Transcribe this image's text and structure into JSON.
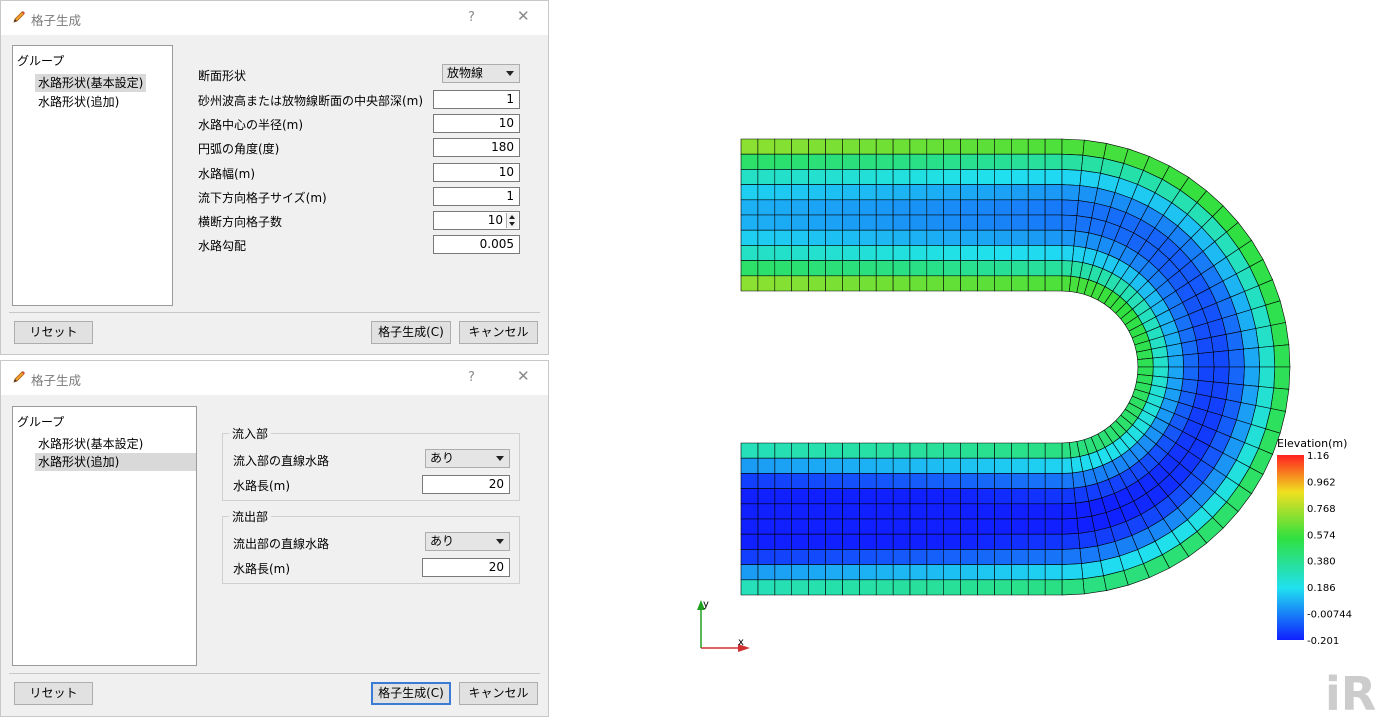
{
  "dialog1": {
    "title": "格子生成",
    "help": "?",
    "close": "✕",
    "group_title": "グループ",
    "groups": [
      "水路形状(基本設定)",
      "水路形状(追加)"
    ],
    "selected_group": 0,
    "section_shape_label": "断面形状",
    "section_shape_value": "放物線",
    "fields": [
      {
        "label": "砂州波高または放物線断面の中央部深(m)",
        "value": "1"
      },
      {
        "label": "水路中心の半径(m)",
        "value": "10"
      },
      {
        "label": "円弧の角度(度)",
        "value": "180"
      },
      {
        "label": "水路幅(m)",
        "value": "10"
      },
      {
        "label": "流下方向格子サイズ(m)",
        "value": "1"
      },
      {
        "label": "横断方向格子数",
        "value": "10"
      },
      {
        "label": "水路勾配",
        "value": "0.005"
      }
    ],
    "reset_label": "リセット",
    "generate_label": "格子生成(C)",
    "cancel_label": "キャンセル"
  },
  "dialog2": {
    "title": "格子生成",
    "help": "?",
    "close": "✕",
    "group_title": "グループ",
    "groups": [
      "水路形状(基本設定)",
      "水路形状(追加)"
    ],
    "selected_group": 1,
    "inflow": {
      "title": "流入部",
      "straight_label": "流入部の直線水路",
      "straight_value": "あり",
      "length_label": "水路長(m)",
      "length_value": "20"
    },
    "outflow": {
      "title": "流出部",
      "straight_label": "流出部の直線水路",
      "straight_value": "あり",
      "length_label": "水路長(m)",
      "length_value": "20"
    },
    "reset_label": "リセット",
    "generate_label": "格子生成(C)",
    "cancel_label": "キャンセル"
  },
  "viewer": {
    "colorbar_title": "Elevation(m)",
    "colorbar_ticks": [
      "1.16",
      "0.962",
      "0.768",
      "0.574",
      "0.380",
      "0.186",
      "-0.00744",
      "-0.201"
    ],
    "colorbar_range": [
      -0.201,
      1.16
    ],
    "axis_x_label": "x",
    "axis_y_label": "y",
    "logo_text": "iR",
    "colors": {
      "axis_x": "#d03030",
      "axis_y": "#20a020",
      "grid_line": "#000000",
      "logo": "#cccccc"
    }
  }
}
